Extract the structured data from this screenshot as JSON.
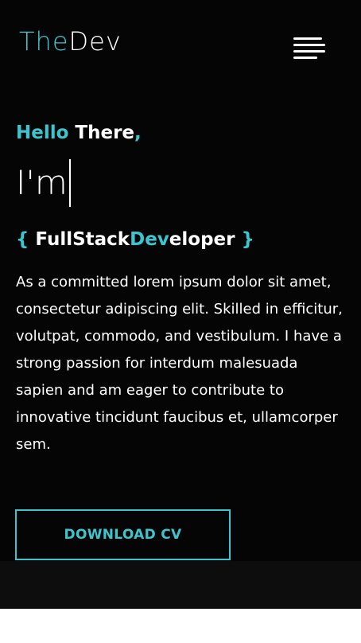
{
  "header": {
    "logo_part1": "The",
    "logo_part2": "Dev",
    "menu_icon": "hamburger-menu-icon"
  },
  "hero": {
    "greeting_highlight": "Hello",
    "greeting_rest": " There",
    "greeting_comma": ",",
    "typed_text": "I'm",
    "role_open_brace": "{",
    "role_part1": "FullStack",
    "role_part2": "Dev",
    "role_part3": "eloper",
    "role_close_brace": "}",
    "description": "As a committed lorem ipsum dolor sit amet, consectetur adipiscing elit. Skilled in efficitur, volutpat, commodo, and vestibulum. I have a strong passion for interdum malesuada sapien and am eager to contribute to innovative tincidunt faucibus et, ullamcorper sem.",
    "download_button_label": "DOWNLOAD CV"
  },
  "colors": {
    "accent": "#3bc6cf",
    "background": "#050505",
    "text": "#ffffff"
  }
}
